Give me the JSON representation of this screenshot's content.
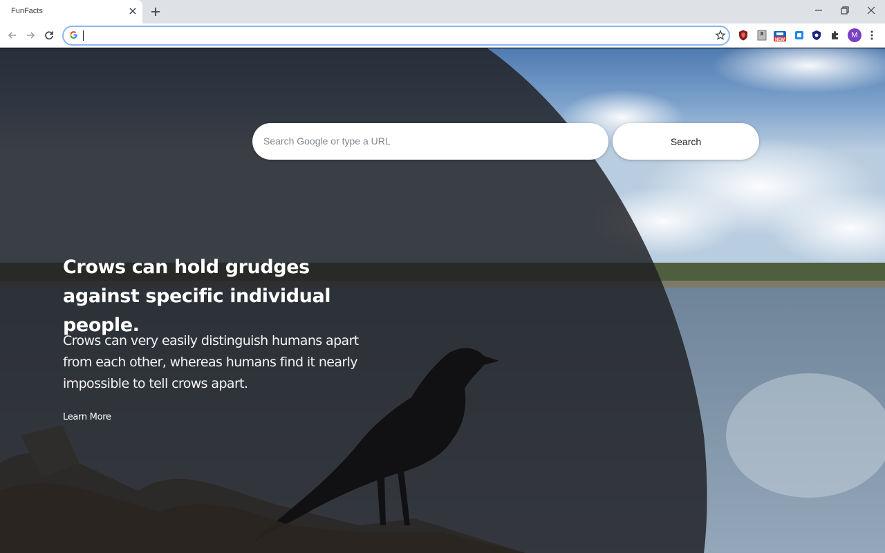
{
  "browser": {
    "tab": {
      "title": "FunFacts"
    },
    "omnibox": {
      "value": ""
    },
    "profile_initial": "M"
  },
  "search": {
    "placeholder": "Search Google or type a URL",
    "button_label": "Search"
  },
  "fact": {
    "title": "Crows can hold grudges against specific individual people.",
    "body": "Crows can very easily distinguish humans apart from each other, whereas humans find it nearly impossible to tell crows apart.",
    "link_label": "Learn More"
  },
  "colors": {
    "accent": "#8ab4f8",
    "overlay": "#1e1f22",
    "avatar": "#7b3fc4"
  },
  "icons": [
    "close-icon",
    "plus-icon",
    "minimize-icon",
    "restore-icon",
    "window-close-icon",
    "back-icon",
    "forward-icon",
    "reload-icon",
    "google-icon",
    "star-icon",
    "shield-extension-icon",
    "bookmark-extension-icon",
    "news-extension-icon",
    "tab-extension-icon",
    "privacy-extension-icon",
    "puzzle-icon",
    "kebab-menu-icon"
  ]
}
